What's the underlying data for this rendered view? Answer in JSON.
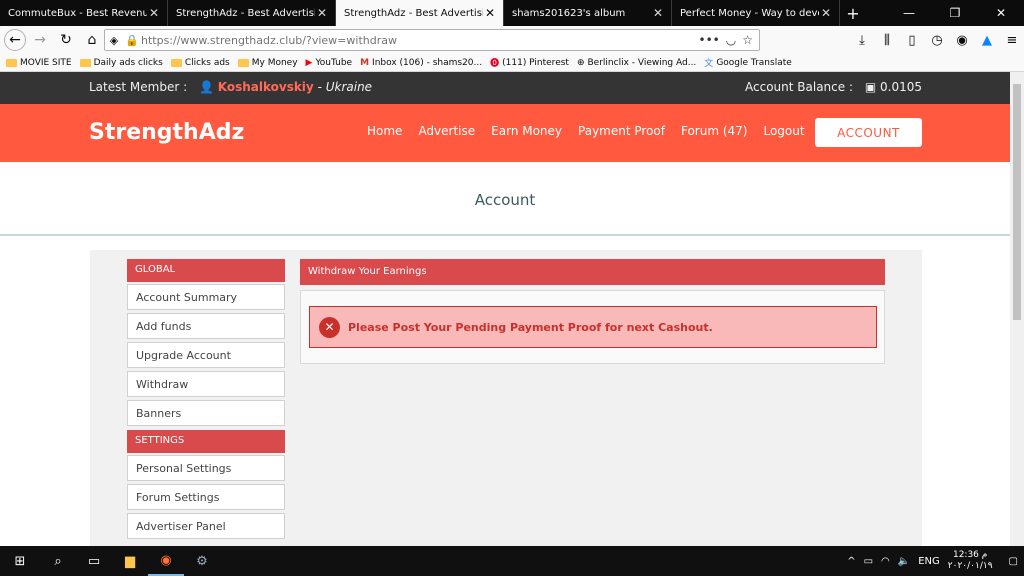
{
  "browser": {
    "tabs": [
      {
        "title": "CommuteBux - Best Revenue Share",
        "active": false
      },
      {
        "title": "StrengthAdz - Best Advertising Plac",
        "active": false
      },
      {
        "title": "StrengthAdz - Best Advertising Plac",
        "active": true
      },
      {
        "title": "shams201623's album",
        "active": false
      },
      {
        "title": "Perfect Money - Way to develop yo",
        "active": false
      }
    ],
    "url_host": "https://www.strengthadz.club",
    "url_rest": "/?view=withdraw",
    "bookmarks": [
      {
        "label": "MOVIE SITE",
        "icon": "folder-icon"
      },
      {
        "label": "Daily ads clicks",
        "icon": "folder-icon"
      },
      {
        "label": "Clicks ads",
        "icon": "folder-icon"
      },
      {
        "label": "My Money",
        "icon": "folder-icon"
      },
      {
        "label": "YouTube",
        "icon": "youtube-icon"
      },
      {
        "label": "Inbox (106) - shams20...",
        "icon": "gmail-icon"
      },
      {
        "label": "(111) Pinterest",
        "icon": "pinterest-icon"
      },
      {
        "label": "Berlinclix - Viewing Ad...",
        "icon": "globe-icon"
      },
      {
        "label": "Google Translate",
        "icon": "translate-icon"
      }
    ]
  },
  "site": {
    "topstrip": {
      "latest_member_label": "Latest Member :",
      "member_name": "Koshalkovskiy",
      "member_country": "- Ukraine",
      "balance_label": "Account Balance :",
      "balance_value": "0.0105"
    },
    "logo": "StrengthAdz",
    "nav": [
      "Home",
      "Advertise",
      "Earn Money",
      "Payment Proof",
      "Forum (47)",
      "Logout"
    ],
    "account_button": "ACCOUNT",
    "page_title": "Account",
    "sidebar": {
      "global_heading": "GLOBAL",
      "global_items": [
        "Account Summary",
        "Add funds",
        "Upgrade Account",
        "Withdraw",
        "Banners"
      ],
      "settings_heading": "SETTINGS",
      "settings_items": [
        "Personal Settings",
        "Forum Settings",
        "Advertiser Panel"
      ]
    },
    "panel": {
      "heading": "Withdraw Your Earnings",
      "alert": "Please Post Your Pending Payment Proof for next Cashout."
    }
  },
  "taskbar": {
    "lang": "ENG",
    "time": "12:36 م",
    "date": "٢٠٢٠/٠١/١٩"
  },
  "colors": {
    "brand_orange": "#ff5a40",
    "sidebar_red": "#d84a4c",
    "alert_red": "#c9302c",
    "alert_bg": "#f9b9b9"
  }
}
